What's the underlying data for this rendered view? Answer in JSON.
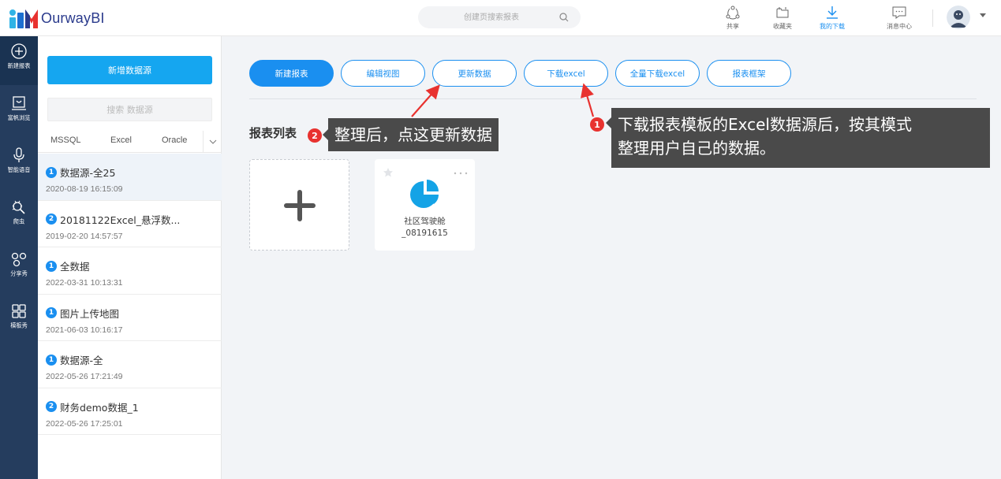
{
  "app": {
    "name": "OurwayBI"
  },
  "header": {
    "search_placeholder": "创建页搜索报表",
    "actions": [
      {
        "label": "共享",
        "icon": "share-icon"
      },
      {
        "label": "收藏夹",
        "icon": "folder-icon"
      },
      {
        "label": "我的下载",
        "icon": "download-icon",
        "active": true
      },
      {
        "label": "消息中心",
        "icon": "message-icon"
      }
    ]
  },
  "rail": {
    "items": [
      {
        "label": "新建报表",
        "icon": "plus-circle-icon"
      },
      {
        "label": "富帆浏览",
        "icon": "browse-icon"
      },
      {
        "label": "智能语音",
        "icon": "microphone-icon"
      },
      {
        "label": "爬虫",
        "icon": "crawler-icon"
      },
      {
        "label": "分享秀",
        "icon": "share-network-icon"
      },
      {
        "label": "模板秀",
        "icon": "template-grid-icon"
      }
    ]
  },
  "datasource_panel": {
    "new_button": "新增数据源",
    "search_placeholder": "搜索 数据源",
    "tabs": [
      "MSSQL",
      "Excel",
      "Oracle"
    ],
    "items": [
      {
        "badge": "1",
        "name": "数据源-全25",
        "date": "2020-08-19 16:15:09",
        "badge_color": "#1a8ff0"
      },
      {
        "badge": "2",
        "name": "20181122Excel_悬浮数...",
        "date": "2019-02-20 14:57:57",
        "badge_color": "#1a8ff0"
      },
      {
        "badge": "1",
        "name": "全数据",
        "date": "2022-03-31 10:13:31",
        "badge_color": "#1a8ff0"
      },
      {
        "badge": "1",
        "name": "图片上传地图",
        "date": "2021-06-03 10:16:17",
        "badge_color": "#1a8ff0"
      },
      {
        "badge": "1",
        "name": "数据源-全",
        "date": "2022-05-26 17:21:49",
        "badge_color": "#1a8ff0"
      },
      {
        "badge": "2",
        "name": "财务demo数据_1",
        "date": "2022-05-26 17:25:01",
        "badge_color": "#1a8ff0"
      }
    ]
  },
  "toolbar": {
    "buttons": [
      "新建报表",
      "编辑视图",
      "更新数据",
      "下载excel",
      "全量下载excel",
      "报表框架"
    ]
  },
  "main": {
    "section_title": "报表列表",
    "report_card": {
      "name_line1": "社区驾驶舱",
      "name_line2": "_08191615"
    }
  },
  "annotations": {
    "callout1": {
      "badge": "2",
      "text": "整理后，点这更新数据"
    },
    "callout2": {
      "badge": "1",
      "line1": "下载报表模板的Excel数据源后，按其模式",
      "line2": "整理用户自己的数据。"
    }
  },
  "colors": {
    "accent": "#1a8ff0",
    "rail": "#253d5e",
    "annotation_red": "#e8322f",
    "callout_bg": "#4a4a4a"
  }
}
